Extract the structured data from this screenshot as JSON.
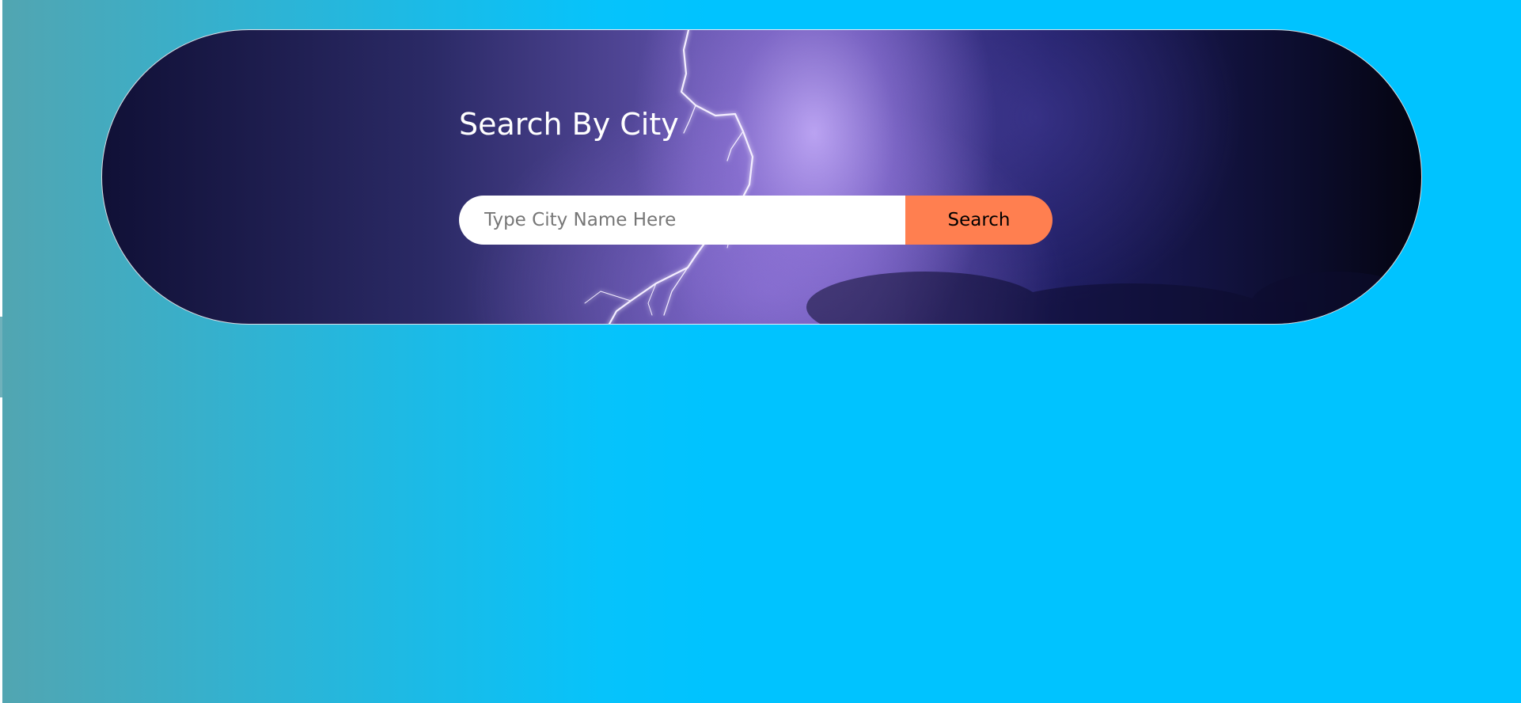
{
  "hero": {
    "title": "Search By City",
    "background_image": "lightning-storm-clouds"
  },
  "search": {
    "placeholder": "Type City Name Here",
    "value": "",
    "button_label": "Search"
  },
  "colors": {
    "page_gradient_start": "#52a5b1",
    "page_gradient_end": "#00c3ff",
    "search_button": "#ff7f50",
    "input_background": "#ffffff",
    "title_text": "#ffffff"
  }
}
